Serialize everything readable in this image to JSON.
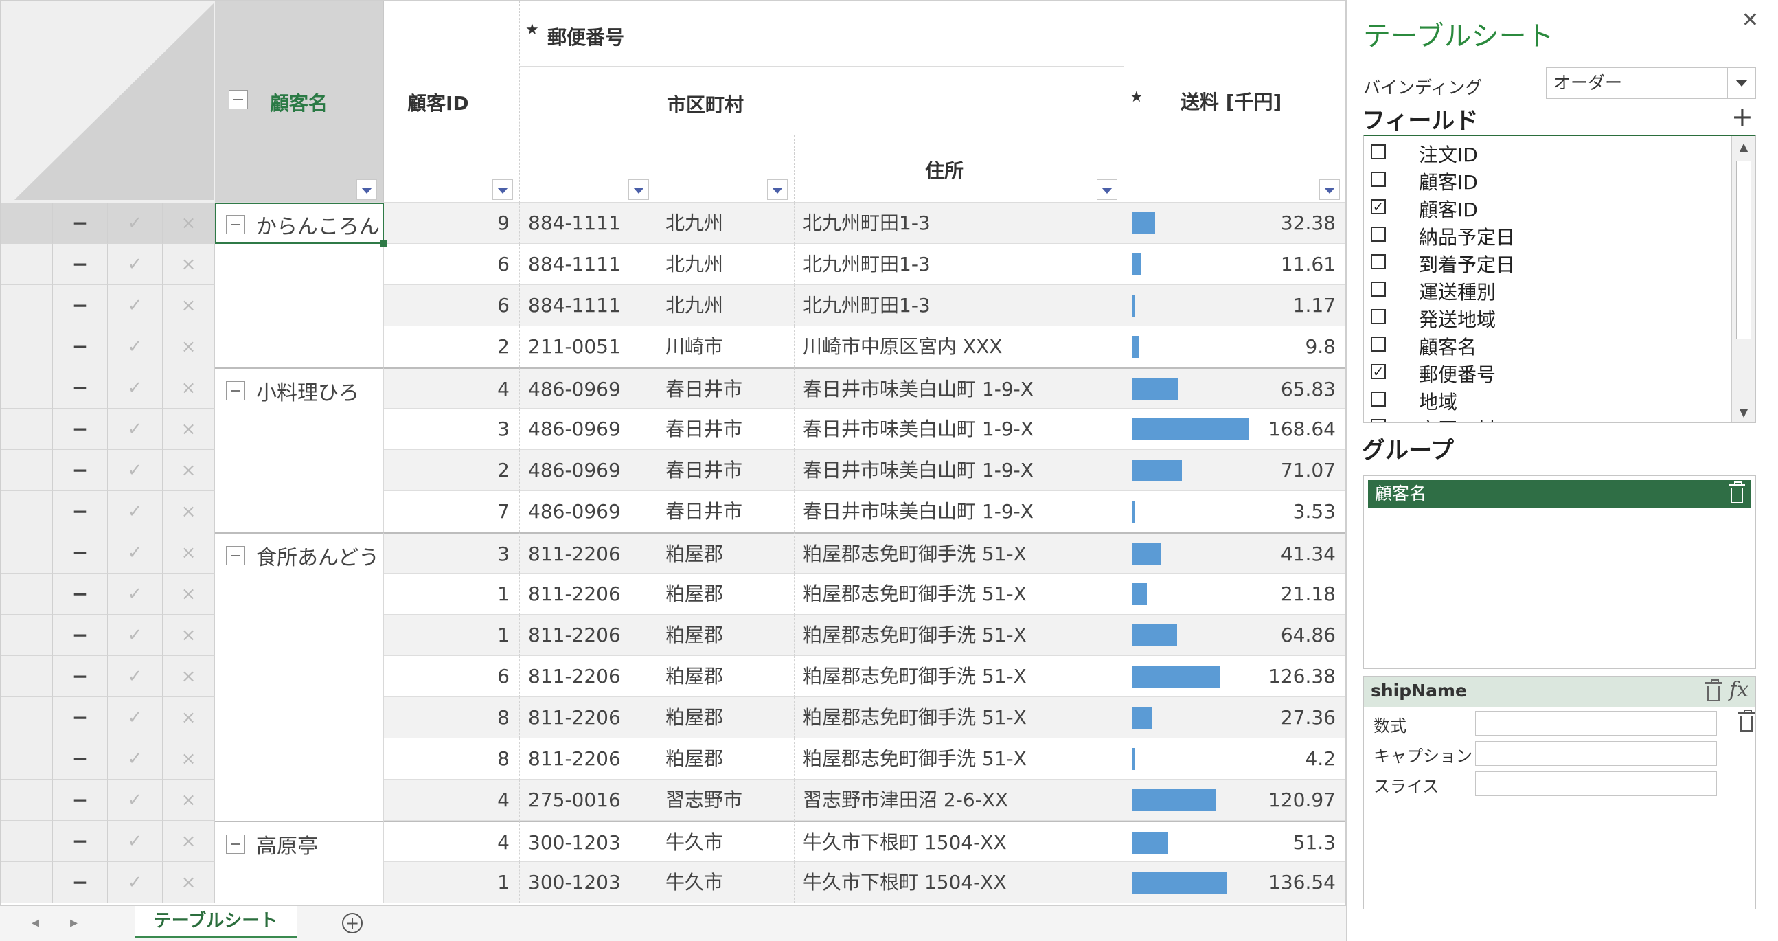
{
  "grid": {
    "headers": {
      "customer_name": "顧客名",
      "customer_id": "顧客ID",
      "postal_code": "郵便番号",
      "city": "市区町村",
      "address": "住所",
      "shipping_fee": "送料 [千円]",
      "star": "★"
    },
    "row_header_symbols": {
      "delete": "−",
      "confirm": "✓",
      "cancel": "×"
    },
    "groups": [
      {
        "name": "からんころん",
        "start": 0,
        "rows": 4
      },
      {
        "name": "小料理ひろ",
        "start": 4,
        "rows": 4
      },
      {
        "name": "食所あんどう",
        "start": 8,
        "rows": 7
      },
      {
        "name": "高原亭",
        "start": 15,
        "rows": 2
      }
    ],
    "rows": [
      {
        "customer_id": "9",
        "postal": "884-1111",
        "city": "北九州",
        "address": "北九州町田1-3",
        "fee": "32.38",
        "fee_value": 32.38
      },
      {
        "customer_id": "6",
        "postal": "884-1111",
        "city": "北九州",
        "address": "北九州町田1-3",
        "fee": "11.61",
        "fee_value": 11.61
      },
      {
        "customer_id": "6",
        "postal": "884-1111",
        "city": "北九州",
        "address": "北九州町田1-3",
        "fee": "1.17",
        "fee_value": 1.17
      },
      {
        "customer_id": "2",
        "postal": "211-0051",
        "city": "川崎市",
        "address": "川崎市中原区宮内 XXX",
        "fee": "9.8",
        "fee_value": 9.8
      },
      {
        "customer_id": "4",
        "postal": "486-0969",
        "city": "春日井市",
        "address": "春日井市味美白山町 1-9-X",
        "fee": "65.83",
        "fee_value": 65.83
      },
      {
        "customer_id": "3",
        "postal": "486-0969",
        "city": "春日井市",
        "address": "春日井市味美白山町 1-9-X",
        "fee": "168.64",
        "fee_value": 168.64
      },
      {
        "customer_id": "2",
        "postal": "486-0969",
        "city": "春日井市",
        "address": "春日井市味美白山町 1-9-X",
        "fee": "71.07",
        "fee_value": 71.07
      },
      {
        "customer_id": "7",
        "postal": "486-0969",
        "city": "春日井市",
        "address": "春日井市味美白山町 1-9-X",
        "fee": "3.53",
        "fee_value": 3.53
      },
      {
        "customer_id": "3",
        "postal": "811-2206",
        "city": "粕屋郡",
        "address": "粕屋郡志免町御手洗 51-X",
        "fee": "41.34",
        "fee_value": 41.34
      },
      {
        "customer_id": "1",
        "postal": "811-2206",
        "city": "粕屋郡",
        "address": "粕屋郡志免町御手洗 51-X",
        "fee": "21.18",
        "fee_value": 21.18
      },
      {
        "customer_id": "1",
        "postal": "811-2206",
        "city": "粕屋郡",
        "address": "粕屋郡志免町御手洗 51-X",
        "fee": "64.86",
        "fee_value": 64.86
      },
      {
        "customer_id": "6",
        "postal": "811-2206",
        "city": "粕屋郡",
        "address": "粕屋郡志免町御手洗 51-X",
        "fee": "126.38",
        "fee_value": 126.38
      },
      {
        "customer_id": "8",
        "postal": "811-2206",
        "city": "粕屋郡",
        "address": "粕屋郡志免町御手洗 51-X",
        "fee": "27.36",
        "fee_value": 27.36
      },
      {
        "customer_id": "8",
        "postal": "811-2206",
        "city": "粕屋郡",
        "address": "粕屋郡志免町御手洗 51-X",
        "fee": "4.2",
        "fee_value": 4.2
      },
      {
        "customer_id": "4",
        "postal": "275-0016",
        "city": "習志野市",
        "address": "習志野市津田沼 2-6-XX",
        "fee": "120.97",
        "fee_value": 120.97
      },
      {
        "customer_id": "4",
        "postal": "300-1203",
        "city": "牛久市",
        "address": "牛久市下根町 1504-XX",
        "fee": "51.3",
        "fee_value": 51.3
      },
      {
        "customer_id": "1",
        "postal": "300-1203",
        "city": "牛久市",
        "address": "牛久市下根町 1504-XX",
        "fee": "136.54",
        "fee_value": 136.54
      }
    ],
    "bar_color": "#5b9bd5"
  },
  "tabs": {
    "sheet_tab_label": "テーブルシート",
    "prev_icon": "◂",
    "next_icon": "▸",
    "add_icon": "+"
  },
  "panel": {
    "title": "テーブルシート",
    "close_icon": "✕",
    "binding_label": "バインディング",
    "binding_value": "オーダー",
    "fields_heading": "フィールド",
    "add_field_icon": "+",
    "fields": [
      {
        "label": "注文ID",
        "checked": false
      },
      {
        "label": "顧客ID",
        "checked": false
      },
      {
        "label": "顧客ID",
        "checked": true
      },
      {
        "label": "納品予定日",
        "checked": false
      },
      {
        "label": "到着予定日",
        "checked": false
      },
      {
        "label": "運送種別",
        "checked": false
      },
      {
        "label": "発送地域",
        "checked": false
      },
      {
        "label": "顧客名",
        "checked": false
      },
      {
        "label": "郵便番号",
        "checked": true
      },
      {
        "label": "地域",
        "checked": false
      },
      {
        "label": "市区町村",
        "checked": true
      }
    ],
    "group_heading": "グループ",
    "group_chip": "顧客名",
    "field_editor": {
      "name": "shipName",
      "fx_icon": "fx",
      "formula_label": "数式",
      "caption_label": "キャプション",
      "slice_label": "スライス"
    },
    "accent_color": "#2b8a3e"
  }
}
